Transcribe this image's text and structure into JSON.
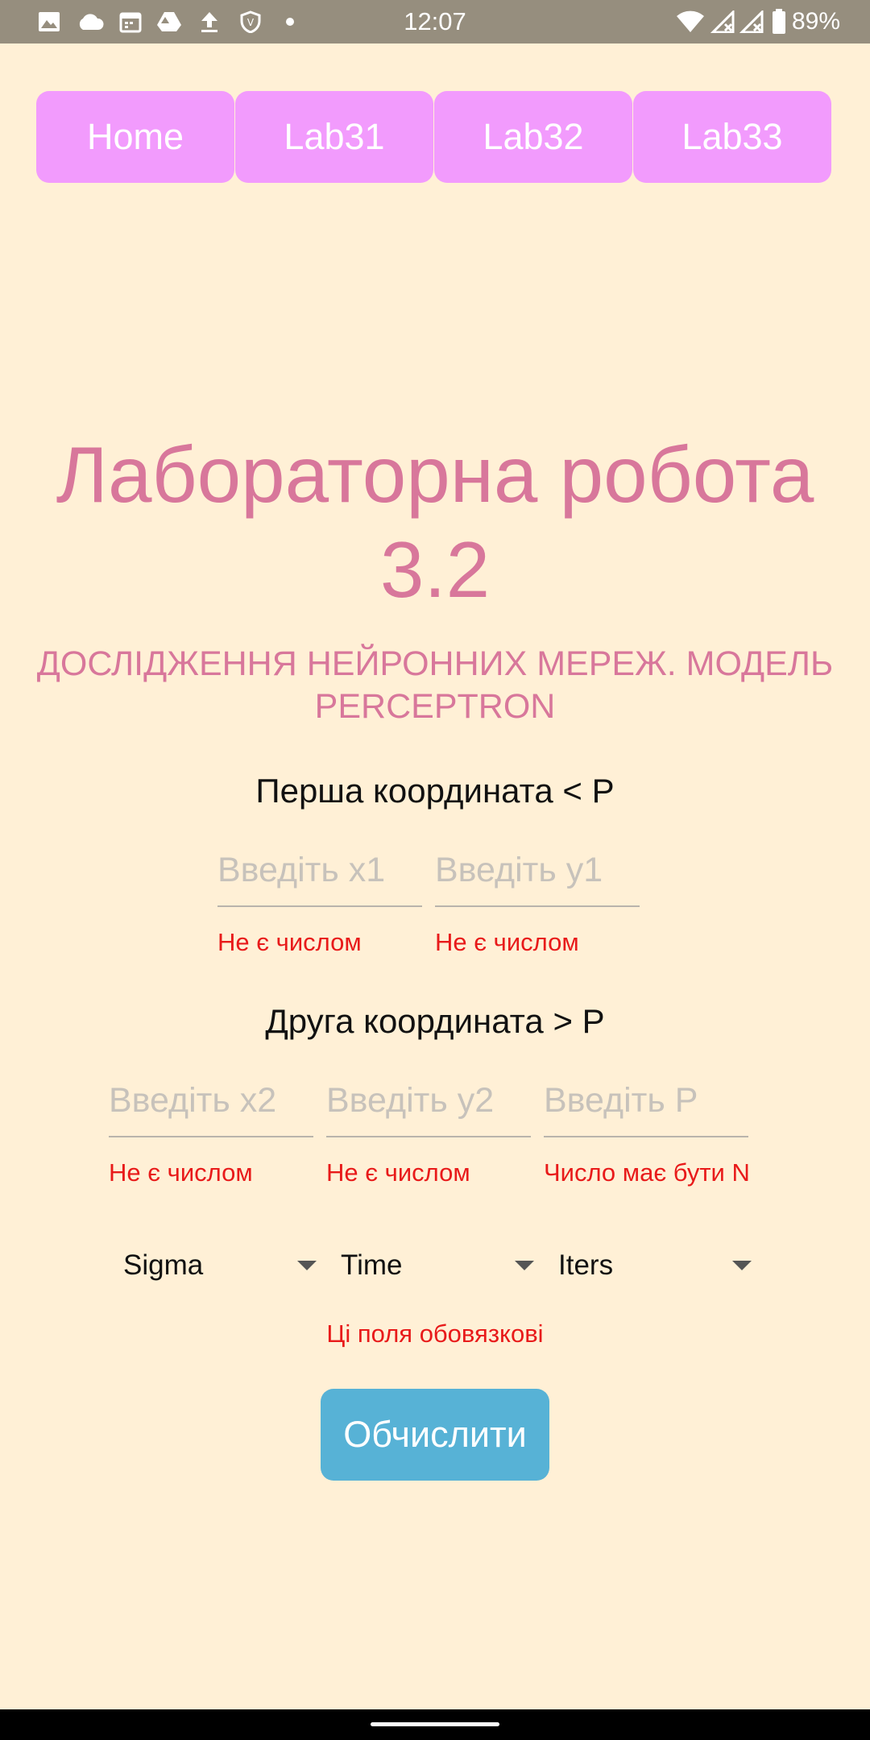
{
  "status_bar": {
    "time": "12:07",
    "battery": "89%",
    "icons": [
      "image-icon",
      "cloud-icon",
      "calendar-icon",
      "drive-icon",
      "upload-icon",
      "shield-icon",
      "dot-icon",
      "wifi-icon",
      "signal-icon",
      "signal-icon",
      "battery-icon"
    ]
  },
  "nav": {
    "items": [
      {
        "label": "Home"
      },
      {
        "label": "Lab31"
      },
      {
        "label": "Lab32"
      },
      {
        "label": "Lab33"
      }
    ],
    "color": "#F29BFD"
  },
  "header": {
    "title_line1": "Лабораторна робота",
    "title_line2": "3.2",
    "subtitle_line1": "ДОСЛІДЖЕННЯ НЕЙРОННИХ МЕРЕЖ. МОДЕЛЬ",
    "subtitle_line2": "PERCEPTRON",
    "color": "#D8779B"
  },
  "first": {
    "label": "Перша координата < P",
    "x1_placeholder": "Введіть x1",
    "y1_placeholder": "Введіть y1",
    "x1_error": "Не є числом",
    "y1_error": "Не є числом"
  },
  "second": {
    "label": "Друга координата > P",
    "x2_placeholder": "Введіть x2",
    "y2_placeholder": "Введіть y2",
    "p_placeholder": "Введіть P",
    "x2_error": "Не є числом",
    "y2_error": "Не є числом",
    "p_error": "Число має бути N"
  },
  "selects": {
    "sigma": "Sigma",
    "time": "Time",
    "iters": "Iters"
  },
  "required_message": "Ці поля обовязкові",
  "calculate_button": "Обчислити",
  "colors": {
    "background": "#FFF0D6",
    "error": "#E81A1A",
    "button": "#57B2D6",
    "status_bar": "#968E7E"
  }
}
